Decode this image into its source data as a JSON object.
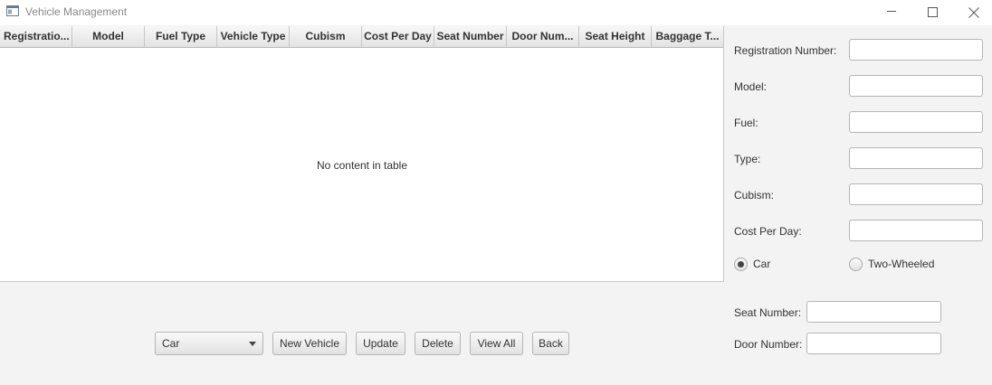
{
  "window": {
    "title": "Vehicle Management"
  },
  "table": {
    "columns": [
      "Registratio...",
      "Model",
      "Fuel Type",
      "Vehicle Type",
      "Cubism",
      "Cost Per Day",
      "Seat Number",
      "Door Num...",
      "Seat Height",
      "Baggage T..."
    ],
    "rows": [],
    "empty_message": "No content in table"
  },
  "form": {
    "registration_label": "Registration Number:",
    "registration_value": "",
    "model_label": "Model:",
    "model_value": "",
    "fuel_label": "Fuel:",
    "fuel_value": "",
    "type_label": "Type:",
    "type_value": "",
    "cubism_label": "Cubism:",
    "cubism_value": "",
    "cost_label": "Cost Per Day:",
    "cost_value": "",
    "radio_car_label": "Car",
    "radio_car_selected": true,
    "radio_two_wheeled_label": "Two-Wheeled",
    "radio_two_wheeled_selected": false,
    "seat_number_label": "Seat Number:",
    "seat_number_value": "",
    "door_number_label": "Door Number:",
    "door_number_value": ""
  },
  "toolbar": {
    "vehicle_kind_selected": "Car",
    "new_vehicle_label": "New Vehicle",
    "update_label": "Update",
    "delete_label": "Delete",
    "view_all_label": "View All",
    "back_label": "Back"
  },
  "icons": {
    "app": "window-app-icon",
    "minimize": "minimize-icon",
    "maximize": "maximize-icon",
    "close": "close-icon"
  }
}
